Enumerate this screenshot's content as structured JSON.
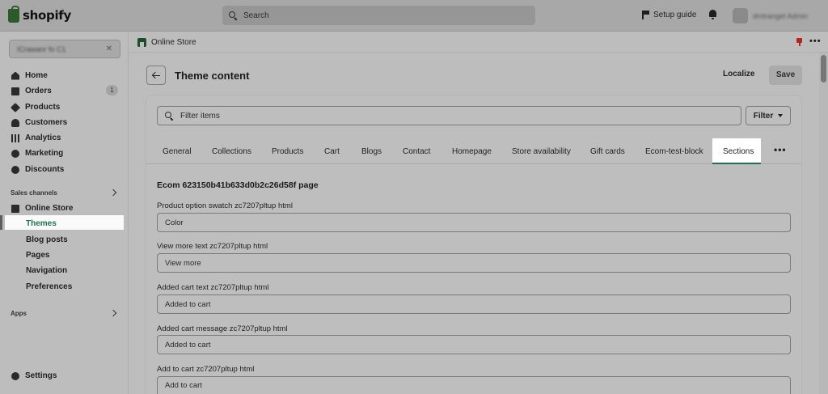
{
  "app": {
    "logo_text": "shopify",
    "search_placeholder": "Search",
    "setup_guide": "Setup guide",
    "user_name": "dmtranget Admin"
  },
  "sidebar": {
    "store_name": "ICrawanr fo C1",
    "items": [
      {
        "label": "Home",
        "icon": "home-icon"
      },
      {
        "label": "Orders",
        "icon": "orders-icon",
        "badge": "1"
      },
      {
        "label": "Products",
        "icon": "tag-icon"
      },
      {
        "label": "Customers",
        "icon": "person-icon"
      },
      {
        "label": "Analytics",
        "icon": "bar-chart-icon"
      },
      {
        "label": "Marketing",
        "icon": "target-icon"
      },
      {
        "label": "Discounts",
        "icon": "discount-icon"
      }
    ],
    "sales_channels_label": "Sales channels",
    "online_store_label": "Online Store",
    "sub_items": [
      "Themes",
      "Blog posts",
      "Pages",
      "Navigation",
      "Preferences"
    ],
    "apps_label": "Apps",
    "settings_label": "Settings"
  },
  "breadcrumb": {
    "label": "Online Store",
    "more": "•••"
  },
  "page": {
    "title": "Theme content",
    "localize_label": "Localize",
    "save_label": "Save"
  },
  "filter": {
    "placeholder": "Filter items",
    "button_label": "Filter"
  },
  "tabs": [
    "General",
    "Collections",
    "Products",
    "Cart",
    "Blogs",
    "Contact",
    "Homepage",
    "Store availability",
    "Gift cards",
    "Ecom-test-block",
    "Sections"
  ],
  "active_tab": "Sections",
  "tabs_more": "•••",
  "section": {
    "title": "Ecom 623150b41b633d0b2c26d58f page",
    "fields": [
      {
        "label": "Product option swatch zc7207pltup html",
        "value": "Color"
      },
      {
        "label": "View more text zc7207pltup html",
        "value": "View more"
      },
      {
        "label": "Added cart text zc7207pltup html",
        "value": "Added to cart"
      },
      {
        "label": "Added cart message zc7207pltup html",
        "value": "Added to cart"
      },
      {
        "label": "Add to cart zc7207pltup html",
        "value": "Add to cart"
      }
    ]
  },
  "colors": {
    "accent_green": "#1b7351",
    "pin_red": "#b3261e"
  }
}
